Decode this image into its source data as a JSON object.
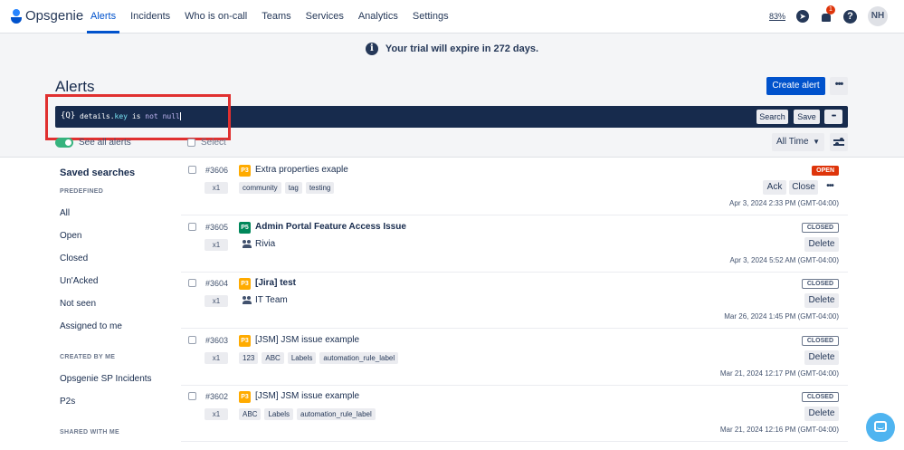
{
  "nav": {
    "logo": "Opsgenie",
    "items": [
      "Alerts",
      "Incidents",
      "Who is on-call",
      "Teams",
      "Services",
      "Analytics",
      "Settings"
    ],
    "battery": "83%",
    "notifications": "1",
    "avatar": "NH"
  },
  "banner": {
    "text": "Your trial will expire in 272 days."
  },
  "page": {
    "title": "Alerts",
    "create_alert": "Create alert",
    "more": "•••"
  },
  "query": {
    "icon": "{Q}",
    "field": "details",
    "dot": ".",
    "key": "key",
    "op_is": "is",
    "op_not": "not",
    "null": "null",
    "help": "?",
    "search": "Search",
    "save": "Save",
    "more": "•••"
  },
  "controls": {
    "see_all": "See all alerts",
    "select": "Select",
    "time_filter": "All Time"
  },
  "sidebar": {
    "title": "Saved searches",
    "predefined_label": "PREDEFINED",
    "predefined": [
      "All",
      "Open",
      "Closed",
      "Un'Acked",
      "Not seen",
      "Assigned to me"
    ],
    "created_label": "CREATED BY ME",
    "created": [
      "Opsgenie SP Incidents",
      "P2s"
    ],
    "shared_label": "SHARED WITH ME"
  },
  "alerts": [
    {
      "num": "#3606",
      "count": "x1",
      "priority": "P3",
      "title": "Extra properties exaple",
      "bold": false,
      "tags": [
        "community",
        "tag",
        "testing"
      ],
      "team": "",
      "status": "OPEN",
      "actions": [
        "Ack",
        "Close"
      ],
      "time": "Apr 3, 2024 2:33 PM (GMT-04:00)"
    },
    {
      "num": "#3605",
      "count": "x1",
      "priority": "P5",
      "title": "Admin Portal Feature Access Issue",
      "bold": true,
      "tags": [],
      "team": "Rivia",
      "status": "CLOSED",
      "actions": [
        "Delete"
      ],
      "time": "Apr 3, 2024 5:52 AM (GMT-04:00)"
    },
    {
      "num": "#3604",
      "count": "x1",
      "priority": "P3",
      "title": "[Jira] test",
      "bold": true,
      "tags": [],
      "team": "IT Team",
      "status": "CLOSED",
      "actions": [
        "Delete"
      ],
      "time": "Mar 26, 2024 1:45 PM (GMT-04:00)"
    },
    {
      "num": "#3603",
      "count": "x1",
      "priority": "P3",
      "title": "[JSM] JSM issue example",
      "bold": false,
      "tags": [
        "123",
        "ABC",
        "Labels",
        "automation_rule_label"
      ],
      "team": "",
      "status": "CLOSED",
      "actions": [
        "Delete"
      ],
      "time": "Mar 21, 2024 12:17 PM (GMT-04:00)"
    },
    {
      "num": "#3602",
      "count": "x1",
      "priority": "P3",
      "title": "[JSM] JSM issue example",
      "bold": false,
      "tags": [
        "ABC",
        "Labels",
        "automation_rule_label"
      ],
      "team": "",
      "status": "CLOSED",
      "actions": [
        "Delete"
      ],
      "time": "Mar 21, 2024 12:16 PM (GMT-04:00)"
    }
  ]
}
